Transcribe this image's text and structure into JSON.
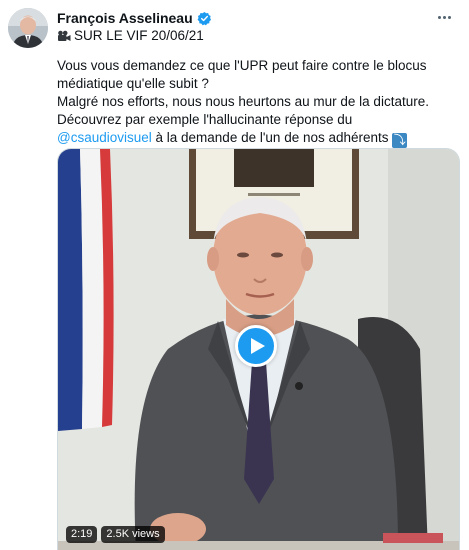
{
  "author": {
    "display_name": "François Asselineau",
    "verified": true
  },
  "tweet": {
    "live_label": "SUR LE VIF 20/06/21",
    "paragraph1": "Vous vous demandez ce que l'UPR peut faire contre le blocus médiatique qu'elle subit ?",
    "paragraph2": "Malgré nos efforts, nous nous heurtons au mur de la dictature.",
    "paragraph3_before": "Découvrez par exemple l'hallucinante réponse du ",
    "mention": "@csaudiovisuel",
    "paragraph3_after": " à la demande de l'un de nos adhérents ",
    "emoji": "⤵"
  },
  "video": {
    "duration": "2:19",
    "views": "2.5K views"
  },
  "icons": {
    "verified": "verified-badge-icon",
    "more": "more-options-icon",
    "camera": "movie-camera-icon",
    "play": "play-icon"
  },
  "colors": {
    "accent": "#1d9bf0",
    "text": "#0f1419",
    "secondary": "#536471"
  }
}
